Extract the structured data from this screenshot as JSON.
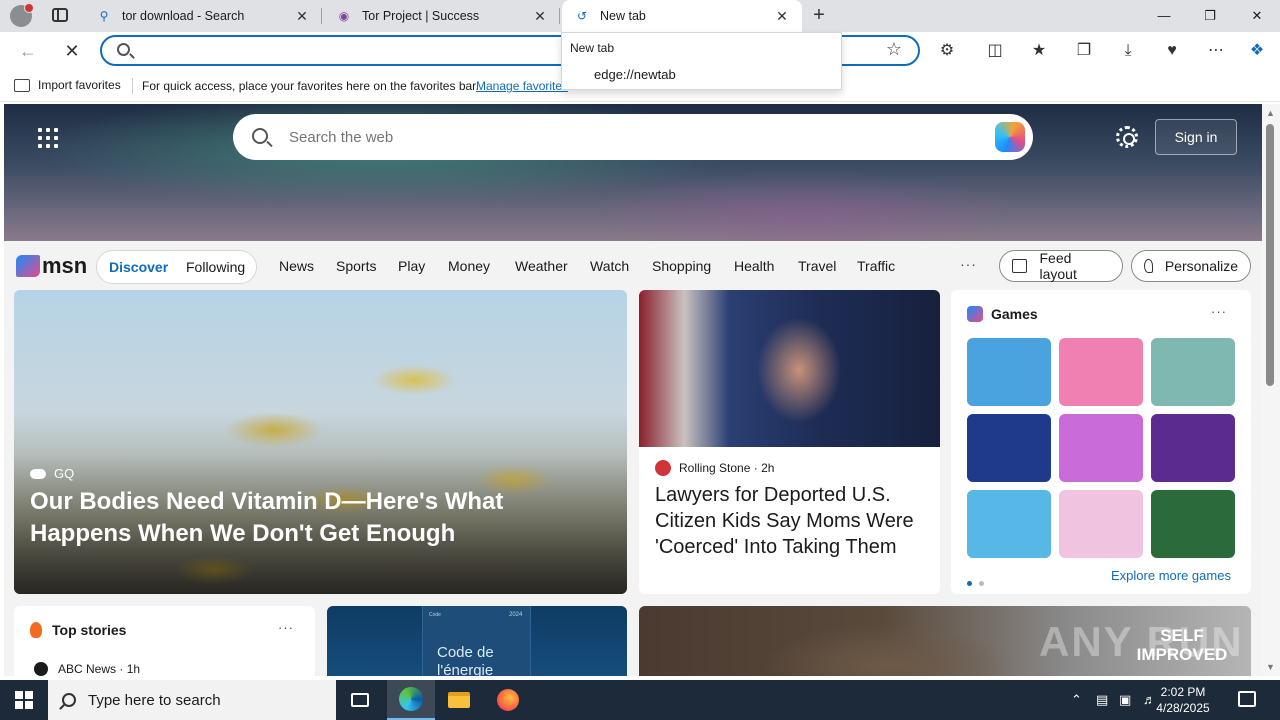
{
  "browser": {
    "tabs": [
      {
        "title": "tor download - Search",
        "icon": "search-icon"
      },
      {
        "title": "Tor Project | Success",
        "icon": "tor-onion-icon"
      },
      {
        "title": "New tab",
        "icon": "loading-icon",
        "active": true
      }
    ],
    "address": {
      "value": "",
      "placeholder": ""
    },
    "suggestion": {
      "header": "New tab",
      "item": "edge://newtab"
    },
    "favorites_bar": {
      "import_label": "Import favorites",
      "message": "For quick access, place your favorites here on the favorites bar.",
      "manage_link": "Manage favorites"
    },
    "accent": "#0f6cbd"
  },
  "msn": {
    "search_placeholder": "Search the web",
    "sign_in": "Sign in",
    "logo": "msn",
    "pills": [
      "Discover",
      "Following"
    ],
    "nav": [
      "News",
      "Sports",
      "Play",
      "Money",
      "Weather",
      "Watch",
      "Shopping",
      "Health",
      "Travel",
      "Traffic"
    ],
    "more": "···",
    "feed_layout": "Feed layout",
    "personalize": "Personalize",
    "featured": {
      "source": "GQ",
      "headline": "Our Bodies Need Vitamin D—Here's What Happens When We Don't Get Enough"
    },
    "news2": {
      "source": "Rolling Stone",
      "age": "2h",
      "headline": "Lawyers for Deported U.S. Citizen Kids Say Moms Were 'Coerced' Into Taking Them"
    },
    "games": {
      "title": "Games",
      "explore": "Explore more games",
      "tile_colors": [
        "#4aa3df",
        "#f07fb2",
        "#7fb8b0",
        "#1f3a8a",
        "#c96bd8",
        "#5b2b8f",
        "#57b8e8",
        "#f0c3e0",
        "#2b6a3a"
      ]
    },
    "top_stories": {
      "title": "Top stories",
      "source": "ABC News",
      "age": "1h"
    },
    "book": {
      "small": "Code",
      "year": "2024",
      "title": "Code de l'énergie"
    },
    "self_improved": {
      "logo": "SELF IMPROVED",
      "watermark": "ANY RUN"
    }
  },
  "taskbar": {
    "search_placeholder": "Type here to search",
    "time": "2:02 PM",
    "date": "4/28/2025"
  }
}
